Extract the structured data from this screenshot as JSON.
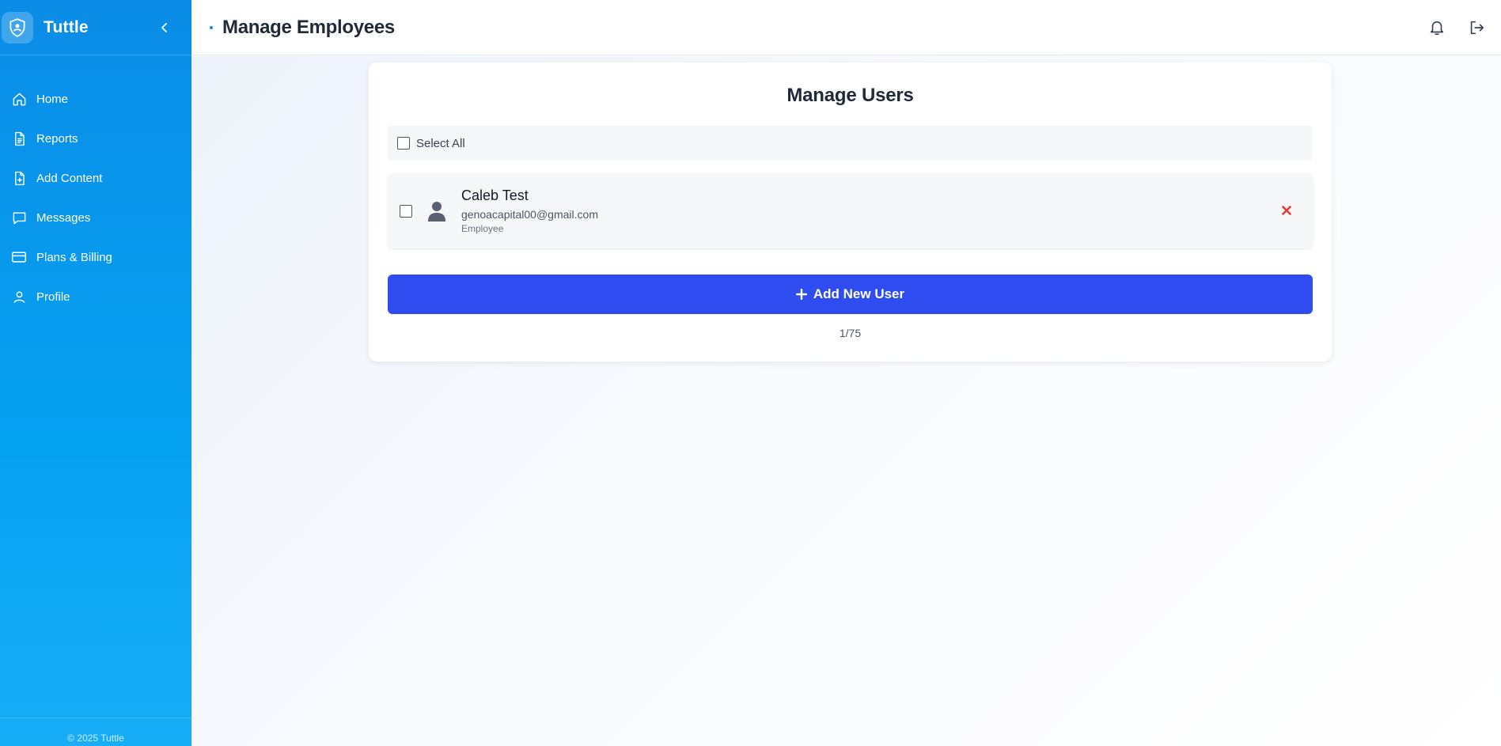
{
  "app": {
    "name": "Tuttle",
    "footer": "© 2025 Tuttle"
  },
  "sidebar": {
    "items": [
      {
        "label": "Home",
        "icon": "home-icon"
      },
      {
        "label": "Reports",
        "icon": "document-icon"
      },
      {
        "label": "Add Content",
        "icon": "file-plus-icon"
      },
      {
        "label": "Messages",
        "icon": "message-icon"
      },
      {
        "label": "Plans & Billing",
        "icon": "credit-card-icon"
      },
      {
        "label": "Profile",
        "icon": "user-icon"
      }
    ]
  },
  "header": {
    "title": "Manage Employees"
  },
  "card": {
    "title": "Manage Users",
    "select_all_label": "Select All",
    "users": [
      {
        "name": "Caleb Test",
        "email": "genoacapital00@gmail.com",
        "role": "Employee"
      }
    ],
    "add_button_label": "Add New User",
    "count": "1/75"
  },
  "colors": {
    "sidebar": "#0a8ce6",
    "primary_button": "#2e4cf0",
    "remove": "#e53935"
  }
}
